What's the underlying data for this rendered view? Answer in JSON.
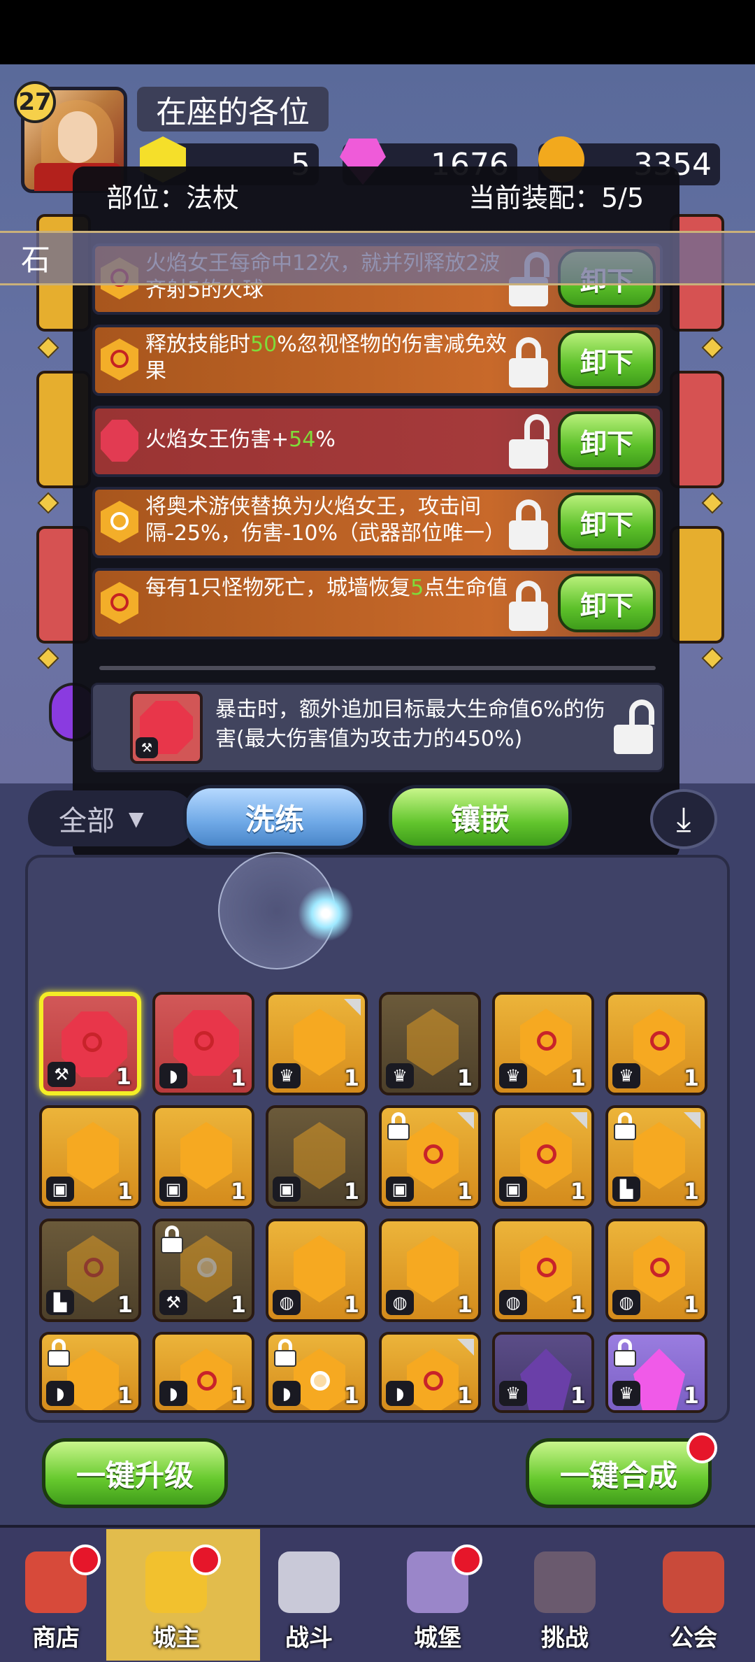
{
  "player": {
    "level": "27",
    "name": "在座的各位"
  },
  "resources": {
    "gold": "5",
    "gems": "1676",
    "coins": "3354"
  },
  "dialog": {
    "part_label": "部位：法杖",
    "equip_count": "当前装配：5/5",
    "strip_text": "石",
    "affixes": [
      {
        "pre": "火焰女王每命中12次，就并列释放2波齐射5的火球",
        "hl": "",
        "post": "",
        "icon": "hex-gem-icon",
        "locked": false,
        "button": "卸下",
        "tone": "orange"
      },
      {
        "pre": "释放技能时",
        "hl": "50",
        "post": "%忽视怪物的伤害减免效果",
        "icon": "hex-gem-icon",
        "locked": true,
        "button": "卸下",
        "tone": "orange"
      },
      {
        "pre": "火焰女王伤害+",
        "hl": "54",
        "post": "%",
        "icon": "ruby-gem-icon",
        "locked": false,
        "button": "卸下",
        "tone": "red"
      },
      {
        "pre": "将奥术游侠替换为火焰女王，攻击间隔-25%，伤害-10%（武器部位唯一）",
        "hl": "",
        "post": "",
        "icon": "star-gem-icon",
        "locked": true,
        "button": "卸下",
        "tone": "orange"
      },
      {
        "pre": "每有1只怪物死亡，城墙恢复",
        "hl": "5",
        "post": "点生命值",
        "icon": "hex-gem-icon",
        "locked": true,
        "button": "卸下",
        "tone": "orange"
      }
    ],
    "socket_desc": "暴击时，额外追加目标最大生命值6%的伤害(最大伤害值为攻击力的450%)",
    "wash_button": "洗练",
    "inlay_button": "镶嵌"
  },
  "filter": {
    "label": "全部"
  },
  "inventory": [
    {
      "gem": "ruby",
      "type": "staff",
      "qty": "1",
      "selected": true
    },
    {
      "gem": "ruby",
      "type": "bow",
      "qty": "1"
    },
    {
      "gem": "hex",
      "type": "crown",
      "qty": "1",
      "corner": true
    },
    {
      "gem": "hex",
      "type": "crown",
      "qty": "1",
      "dim": true
    },
    {
      "gem": "hex-swirl",
      "type": "crown",
      "qty": "1"
    },
    {
      "gem": "hex-swirl",
      "type": "crown",
      "qty": "1"
    },
    {
      "gem": "hex",
      "type": "armor",
      "qty": "1"
    },
    {
      "gem": "hex",
      "type": "armor",
      "qty": "1"
    },
    {
      "gem": "hex",
      "type": "armor",
      "qty": "1",
      "dim": true
    },
    {
      "gem": "hex-swirl",
      "type": "armor",
      "qty": "1",
      "locked": true,
      "corner": true
    },
    {
      "gem": "hex-swirl",
      "type": "armor",
      "qty": "1",
      "corner": true
    },
    {
      "gem": "hex",
      "type": "boot",
      "qty": "1",
      "locked": true,
      "corner": true
    },
    {
      "gem": "hex-swirl",
      "type": "boot",
      "qty": "1",
      "dim": true
    },
    {
      "gem": "hex-star",
      "type": "staff",
      "qty": "1",
      "locked": true,
      "dim": true
    },
    {
      "gem": "hex",
      "type": "ring",
      "qty": "1"
    },
    {
      "gem": "hex",
      "type": "ring",
      "qty": "1"
    },
    {
      "gem": "hex-swirl",
      "type": "ring",
      "qty": "1"
    },
    {
      "gem": "hex-swirl",
      "type": "ring",
      "qty": "1"
    },
    {
      "gem": "hex",
      "type": "bow",
      "qty": "1",
      "locked": true
    },
    {
      "gem": "hex-swirl",
      "type": "bow",
      "qty": "1"
    },
    {
      "gem": "hex-star",
      "type": "bow",
      "qty": "1",
      "locked": true
    },
    {
      "gem": "hex-swirl",
      "type": "bow",
      "qty": "1",
      "corner": true
    },
    {
      "gem": "purple",
      "type": "crown",
      "qty": "1",
      "bg": "purple"
    },
    {
      "gem": "pink",
      "type": "crown",
      "qty": "1",
      "locked": true,
      "bg": "violet"
    }
  ],
  "actions": {
    "upgrade": "一键升级",
    "merge": "一键合成"
  },
  "nav": [
    {
      "label": "商店",
      "icon": "shop-icon",
      "color": "#d74a3a",
      "badge": true,
      "active": false
    },
    {
      "label": "城主",
      "icon": "crown-icon",
      "color": "#f2c12e",
      "badge": true,
      "active": true
    },
    {
      "label": "战斗",
      "icon": "swords-icon",
      "color": "#c9c9d8",
      "badge": false,
      "active": false
    },
    {
      "label": "城堡",
      "icon": "castle-icon",
      "color": "#9a86c9",
      "badge": true,
      "active": false
    },
    {
      "label": "挑战",
      "icon": "demon-icon",
      "color": "#6a5a6e",
      "badge": false,
      "active": false
    },
    {
      "label": "公会",
      "icon": "guild-banner-icon",
      "color": "#c94a3a",
      "badge": false,
      "active": false
    }
  ]
}
